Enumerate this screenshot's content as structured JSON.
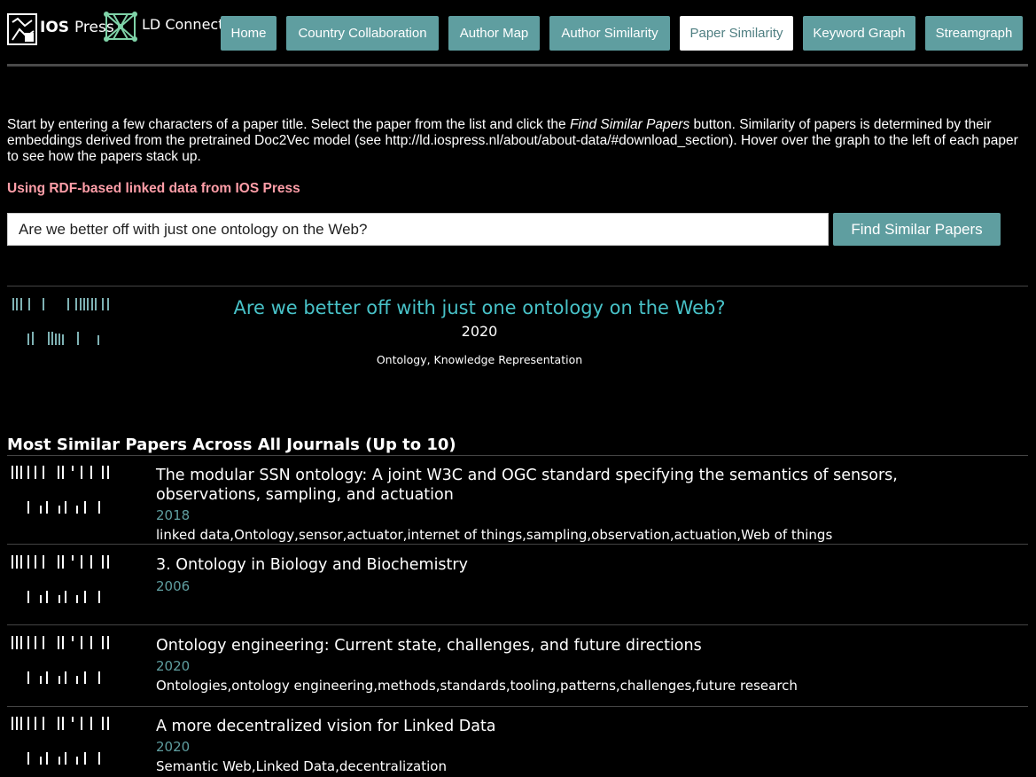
{
  "header": {
    "logo_ios_bold": "IOS",
    "logo_ios_rest": "Press",
    "logo_ld_text": "LD Connect",
    "nav": [
      {
        "label": "Home",
        "active": false
      },
      {
        "label": "Country Collaboration",
        "active": false
      },
      {
        "label": "Author Map",
        "active": false
      },
      {
        "label": "Author Similarity",
        "active": false
      },
      {
        "label": "Paper Similarity",
        "active": true
      },
      {
        "label": "Keyword Graph",
        "active": false
      },
      {
        "label": "Streamgraph",
        "active": false
      }
    ]
  },
  "intro": {
    "before": "Start by entering a few characters of a paper title. Select the paper from the list and click the ",
    "emphasis": "Find Similar Papers",
    "after": " button. Similarity of papers is determined by their embeddings derived from the pretrained Doc2Vec model (see http://ld.iospress.nl/about/about-data/#download_section). Hover over the graph to the left of each paper to see how the papers stack up."
  },
  "source_note": "Using RDF-based linked data from IOS Press",
  "search": {
    "value": "Are we better off with just one ontology on the Web?",
    "button_label": "Find Similar Papers"
  },
  "selected": {
    "title": "Are we better off with just one ontology on the Web?",
    "year": "2020",
    "keywords": "Ontology, Knowledge Representation"
  },
  "similar": {
    "heading": "Most Similar Papers Across All Journals (Up to 10)",
    "papers": [
      {
        "title": "The modular SSN ontology: A joint W3C and OGC standard specifying the semantics of sensors, observations, sampling, and actuation",
        "year": "2018",
        "keywords": "linked data,Ontology,sensor,actuator,internet of things,sampling,observation,actuation,Web of things"
      },
      {
        "title": "3. Ontology in Biology and Biochemistry",
        "year": "2006",
        "keywords": ""
      },
      {
        "title": "Ontology engineering: Current state, challenges, and future directions",
        "year": "2020",
        "keywords": "Ontologies,ontology engineering,methods,standards,tooling,patterns,challenges,future research"
      },
      {
        "title": "A more decentralized vision for Linked Data",
        "year": "2020",
        "keywords": "Semantic Web,Linked Data,decentralization"
      }
    ]
  },
  "colors": {
    "accent": "#5f9ea0",
    "title_highlight": "#48c2c8",
    "source_note": "#ff9ea8",
    "background": "#000000"
  }
}
